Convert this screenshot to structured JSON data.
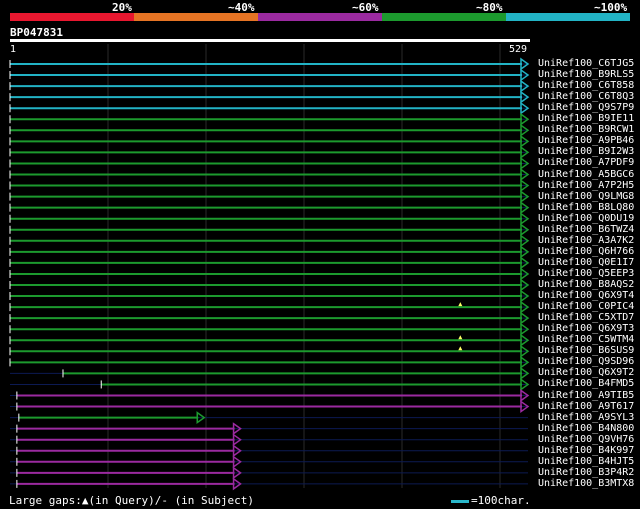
{
  "scale": {
    "labels": [
      "20%",
      "~40%",
      "~60%",
      "~80%",
      "~100%"
    ],
    "colors": [
      "#e8172f",
      "#e67424",
      "#9b2aa0",
      "#1c9a2e",
      "#22b3c5"
    ]
  },
  "query": {
    "name": "BP047831",
    "start": "1",
    "end": "529"
  },
  "hits": [
    {
      "name": "UniRef100_C6TJG5",
      "start": 1,
      "end": 529,
      "color": "#22b3c5"
    },
    {
      "name": "UniRef100_B9RLS5",
      "start": 1,
      "end": 529,
      "color": "#22b3c5"
    },
    {
      "name": "UniRef100_C6T858",
      "start": 1,
      "end": 529,
      "color": "#22b3c5"
    },
    {
      "name": "UniRef100_C6T8Q3",
      "start": 1,
      "end": 529,
      "color": "#22b3c5"
    },
    {
      "name": "UniRef100_Q9S7P9",
      "start": 1,
      "end": 529,
      "color": "#22b3c5"
    },
    {
      "name": "UniRef100_B9IE11",
      "start": 1,
      "end": 529,
      "color": "#1c9a2e"
    },
    {
      "name": "UniRef100_B9RCW1",
      "start": 1,
      "end": 529,
      "color": "#1c9a2e"
    },
    {
      "name": "UniRef100_A9PB46",
      "start": 1,
      "end": 529,
      "color": "#1c9a2e"
    },
    {
      "name": "UniRef100_B9I2W3",
      "start": 1,
      "end": 529,
      "color": "#1c9a2e"
    },
    {
      "name": "UniRef100_A7PDF9",
      "start": 1,
      "end": 529,
      "color": "#1c9a2e"
    },
    {
      "name": "UniRef100_A5BGC6",
      "start": 1,
      "end": 529,
      "color": "#1c9a2e"
    },
    {
      "name": "UniRef100_A7P2H5",
      "start": 1,
      "end": 529,
      "color": "#1c9a2e"
    },
    {
      "name": "UniRef100_Q9LMG8",
      "start": 1,
      "end": 529,
      "color": "#1c9a2e"
    },
    {
      "name": "UniRef100_B8LQ80",
      "start": 1,
      "end": 529,
      "color": "#1c9a2e"
    },
    {
      "name": "UniRef100_Q0DU19",
      "start": 1,
      "end": 529,
      "color": "#1c9a2e"
    },
    {
      "name": "UniRef100_B6TWZ4",
      "start": 1,
      "end": 529,
      "color": "#1c9a2e"
    },
    {
      "name": "UniRef100_A3A7K2",
      "start": 1,
      "end": 529,
      "color": "#1c9a2e"
    },
    {
      "name": "UniRef100_Q6H766",
      "start": 1,
      "end": 529,
      "color": "#1c9a2e"
    },
    {
      "name": "UniRef100_Q0E1I7",
      "start": 1,
      "end": 529,
      "color": "#1c9a2e"
    },
    {
      "name": "UniRef100_Q5EEP3",
      "start": 1,
      "end": 529,
      "color": "#1c9a2e"
    },
    {
      "name": "UniRef100_B8AQS2",
      "start": 1,
      "end": 529,
      "color": "#1c9a2e"
    },
    {
      "name": "UniRef100_Q6X9T4",
      "start": 1,
      "end": 529,
      "color": "#1c9a2e"
    },
    {
      "name": "UniRef100_C0PIC4",
      "start": 1,
      "end": 529,
      "color": "#1c9a2e",
      "gap": true
    },
    {
      "name": "UniRef100_C5XTD7",
      "start": 1,
      "end": 529,
      "color": "#1c9a2e"
    },
    {
      "name": "UniRef100_Q6X9T3",
      "start": 1,
      "end": 529,
      "color": "#1c9a2e"
    },
    {
      "name": "UniRef100_C5WTM4",
      "start": 1,
      "end": 529,
      "color": "#1c9a2e",
      "gap": true
    },
    {
      "name": "UniRef100_B6SUS9",
      "start": 1,
      "end": 529,
      "color": "#1c9a2e",
      "gap": true
    },
    {
      "name": "UniRef100_Q9SD96",
      "start": 1,
      "end": 529,
      "color": "#1c9a2e"
    },
    {
      "name": "UniRef100_Q6X9T2",
      "start": 55,
      "end": 529,
      "color": "#1c9a2e"
    },
    {
      "name": "UniRef100_B4FMD5",
      "start": 94,
      "end": 529,
      "color": "#1c9a2e"
    },
    {
      "name": "UniRef100_A9TIB5",
      "start": 8,
      "end": 529,
      "color": "#9b2aa0"
    },
    {
      "name": "UniRef100_A9T617",
      "start": 8,
      "end": 529,
      "color": "#9b2aa0"
    },
    {
      "name": "UniRef100_A9SYL3",
      "start": 10,
      "end": 199,
      "color": "#1c9a2e"
    },
    {
      "name": "UniRef100_B4N800",
      "start": 8,
      "end": 236,
      "color": "#9b2aa0"
    },
    {
      "name": "UniRef100_Q9VH76",
      "start": 8,
      "end": 236,
      "color": "#9b2aa0"
    },
    {
      "name": "UniRef100_B4K997",
      "start": 8,
      "end": 236,
      "color": "#9b2aa0"
    },
    {
      "name": "UniRef100_B4HJT5",
      "start": 8,
      "end": 236,
      "color": "#9b2aa0"
    },
    {
      "name": "UniRef100_B3P4R2",
      "start": 8,
      "end": 236,
      "color": "#9b2aa0"
    },
    {
      "name": "UniRef100_B3MTX8",
      "start": 8,
      "end": 236,
      "color": "#9b2aa0"
    }
  ],
  "footer": {
    "text": "Large gaps:▲(in Query)/- (in Subject)"
  },
  "legend": {
    "text": "=100char."
  }
}
